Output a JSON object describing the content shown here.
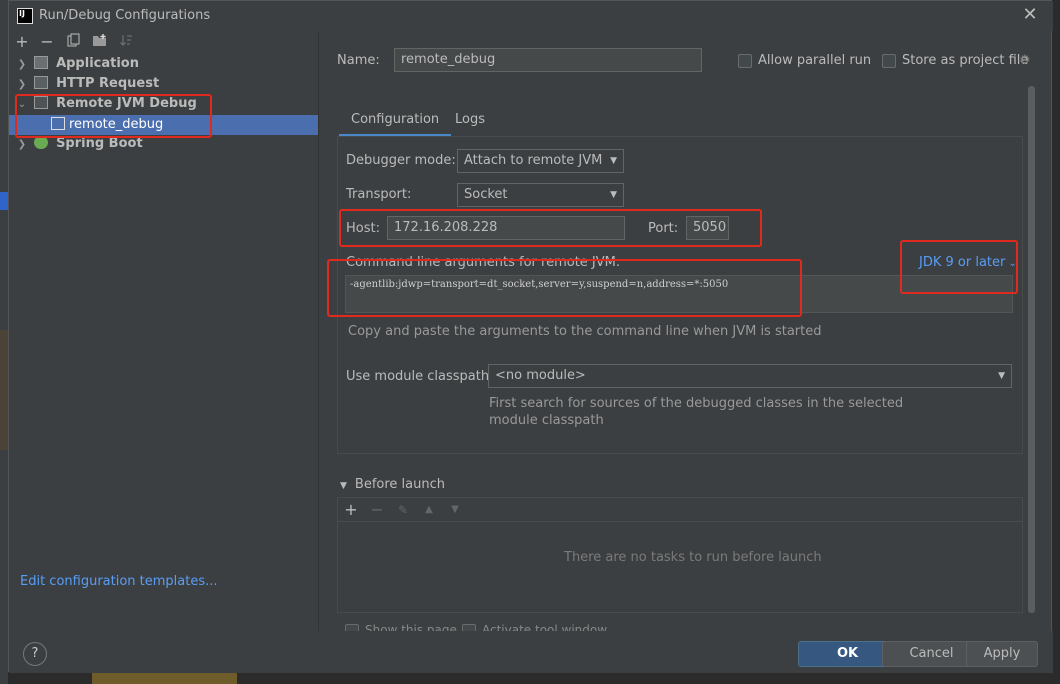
{
  "window": {
    "title": "Run/Debug Configurations",
    "app_icon_text": "IJ"
  },
  "toolbar": {
    "add": "+",
    "remove": "−",
    "copy_icon": "copy-icon",
    "folder_icon": "folder-icon",
    "sort_icon": "sort-icon"
  },
  "tree": {
    "items": [
      {
        "label": "Application",
        "expanded": false
      },
      {
        "label": "HTTP Request",
        "expanded": false
      },
      {
        "label": "Remote JVM Debug",
        "expanded": true
      },
      {
        "label": "Spring Boot",
        "expanded": false
      }
    ],
    "selected_child": "remote_debug"
  },
  "edit_templates": "Edit configuration templates...",
  "name_label": "Name:",
  "name_value": "remote_debug",
  "allow_parallel": "Allow parallel run",
  "store_as_project": "Store as project file",
  "tabs": [
    "Configuration",
    "Logs"
  ],
  "config": {
    "debugger_mode_label": "Debugger mode:",
    "debugger_mode_value": "Attach to remote JVM",
    "transport_label": "Transport:",
    "transport_value": "Socket",
    "host_label": "Host:",
    "host_value": "172.16.208.228",
    "port_label": "Port:",
    "port_value": "5050",
    "cmd_label": "Command line arguments for remote JVM:",
    "jdk_link": "JDK 9 or later",
    "cmd_value": "-agentlib:jdwp=transport=dt_socket,server=y,suspend=n,address=*:5050",
    "cmd_hint": "Copy and paste the arguments to the command line when JVM is started",
    "module_label": "Use module classpath:",
    "module_value": "<no module>",
    "module_hint_1": "First search for sources of the debugged classes in the selected",
    "module_hint_2": "module classpath"
  },
  "before_launch": {
    "title": "Before launch",
    "empty_text": "There are no tasks to run before launch"
  },
  "partial_options": {
    "show_this": "Show this page",
    "activate": "Activate tool window"
  },
  "buttons": {
    "help": "?",
    "ok": "OK",
    "cancel": "Cancel",
    "apply": "Apply"
  },
  "colors": {
    "accent": "#4a88c7",
    "selection": "#4b6eaf",
    "annotation": "#e0291f",
    "link": "#589df6"
  }
}
